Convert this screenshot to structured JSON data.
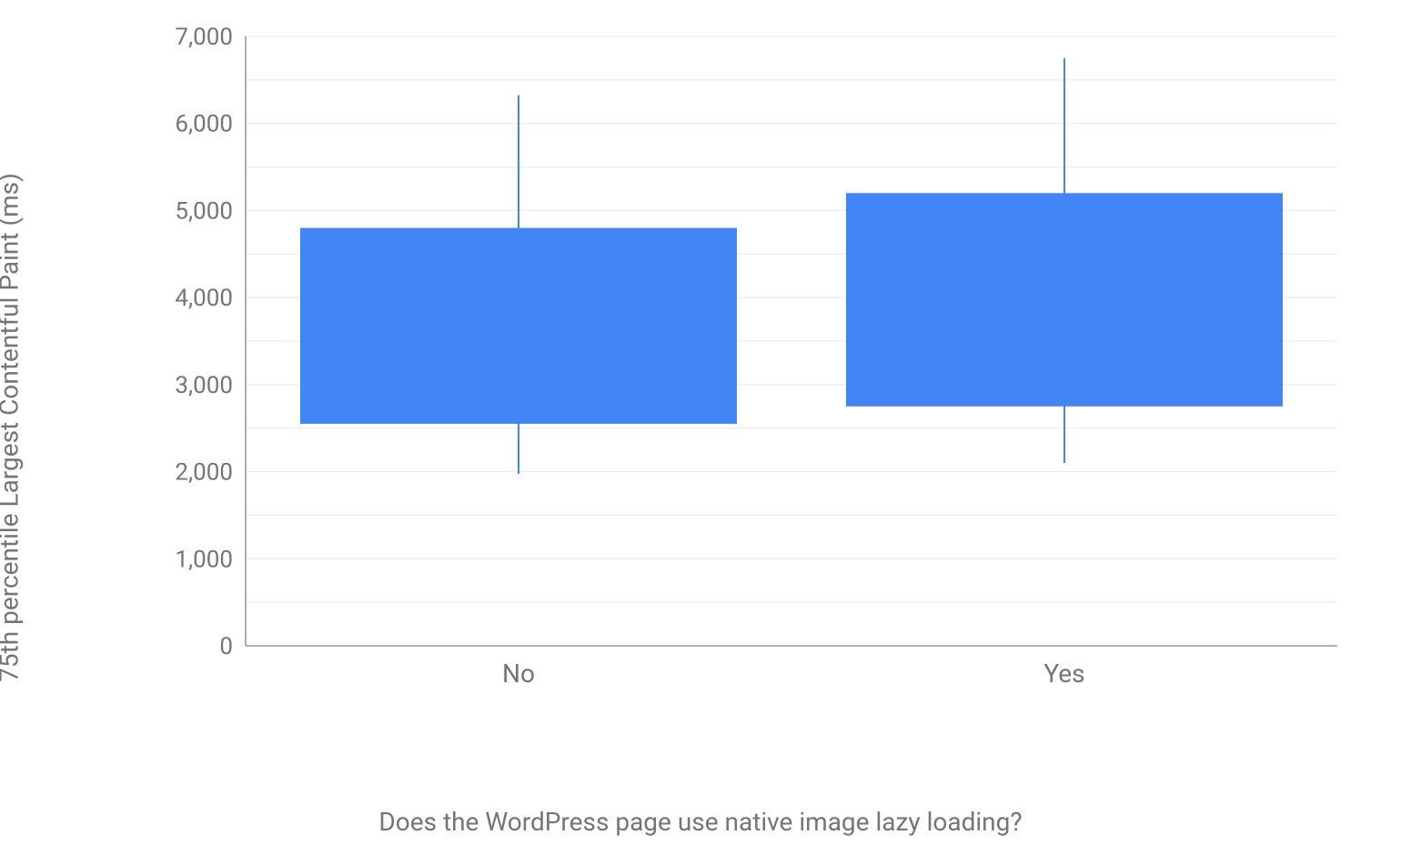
{
  "chart_data": {
    "type": "box",
    "ylabel": "75th percentile Largest Contentful Paint (ms)",
    "xlabel": "Does the WordPress page use native image lazy loading?",
    "ylim": [
      0,
      7000
    ],
    "y_ticks": [
      0,
      1000,
      2000,
      3000,
      4000,
      5000,
      6000,
      7000
    ],
    "categories": [
      "No",
      "Yes"
    ],
    "series": [
      {
        "name": "No",
        "q1": 2550,
        "q3": 4800,
        "whisker_low": 1975,
        "whisker_high": 6325
      },
      {
        "name": "Yes",
        "q1": 2750,
        "q3": 5200,
        "whisker_low": 2100,
        "whisker_high": 6750
      }
    ],
    "colors": {
      "box": "#4285f4",
      "whisker": "#4285f4",
      "grid": "#e8e8e8",
      "axis": "#616161",
      "text": "#757575"
    }
  }
}
